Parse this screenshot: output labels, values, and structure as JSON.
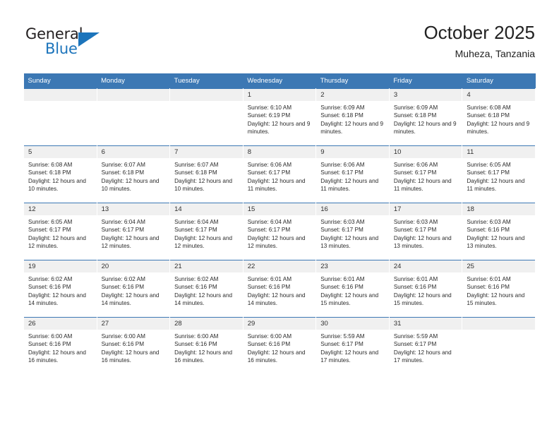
{
  "brand": {
    "line1": "General",
    "line2": "Blue",
    "accent_color": "#1c74bb"
  },
  "header": {
    "title": "October 2025",
    "subtitle": "Muheza, Tanzania"
  },
  "theme": {
    "header_bg": "#3c78b4",
    "daynum_bg": "#f0f0f0",
    "text": "#2b2b2b"
  },
  "weekdays": [
    "Sunday",
    "Monday",
    "Tuesday",
    "Wednesday",
    "Thursday",
    "Friday",
    "Saturday"
  ],
  "weeks": [
    [
      {
        "empty": true
      },
      {
        "empty": true
      },
      {
        "empty": true
      },
      {
        "day": "1",
        "sunrise": "Sunrise: 6:10 AM",
        "sunset": "Sunset: 6:19 PM",
        "daylight": "Daylight: 12 hours and 9 minutes."
      },
      {
        "day": "2",
        "sunrise": "Sunrise: 6:09 AM",
        "sunset": "Sunset: 6:18 PM",
        "daylight": "Daylight: 12 hours and 9 minutes."
      },
      {
        "day": "3",
        "sunrise": "Sunrise: 6:09 AM",
        "sunset": "Sunset: 6:18 PM",
        "daylight": "Daylight: 12 hours and 9 minutes."
      },
      {
        "day": "4",
        "sunrise": "Sunrise: 6:08 AM",
        "sunset": "Sunset: 6:18 PM",
        "daylight": "Daylight: 12 hours and 9 minutes."
      }
    ],
    [
      {
        "day": "5",
        "sunrise": "Sunrise: 6:08 AM",
        "sunset": "Sunset: 6:18 PM",
        "daylight": "Daylight: 12 hours and 10 minutes."
      },
      {
        "day": "6",
        "sunrise": "Sunrise: 6:07 AM",
        "sunset": "Sunset: 6:18 PM",
        "daylight": "Daylight: 12 hours and 10 minutes."
      },
      {
        "day": "7",
        "sunrise": "Sunrise: 6:07 AM",
        "sunset": "Sunset: 6:18 PM",
        "daylight": "Daylight: 12 hours and 10 minutes."
      },
      {
        "day": "8",
        "sunrise": "Sunrise: 6:06 AM",
        "sunset": "Sunset: 6:17 PM",
        "daylight": "Daylight: 12 hours and 11 minutes."
      },
      {
        "day": "9",
        "sunrise": "Sunrise: 6:06 AM",
        "sunset": "Sunset: 6:17 PM",
        "daylight": "Daylight: 12 hours and 11 minutes."
      },
      {
        "day": "10",
        "sunrise": "Sunrise: 6:06 AM",
        "sunset": "Sunset: 6:17 PM",
        "daylight": "Daylight: 12 hours and 11 minutes."
      },
      {
        "day": "11",
        "sunrise": "Sunrise: 6:05 AM",
        "sunset": "Sunset: 6:17 PM",
        "daylight": "Daylight: 12 hours and 11 minutes."
      }
    ],
    [
      {
        "day": "12",
        "sunrise": "Sunrise: 6:05 AM",
        "sunset": "Sunset: 6:17 PM",
        "daylight": "Daylight: 12 hours and 12 minutes."
      },
      {
        "day": "13",
        "sunrise": "Sunrise: 6:04 AM",
        "sunset": "Sunset: 6:17 PM",
        "daylight": "Daylight: 12 hours and 12 minutes."
      },
      {
        "day": "14",
        "sunrise": "Sunrise: 6:04 AM",
        "sunset": "Sunset: 6:17 PM",
        "daylight": "Daylight: 12 hours and 12 minutes."
      },
      {
        "day": "15",
        "sunrise": "Sunrise: 6:04 AM",
        "sunset": "Sunset: 6:17 PM",
        "daylight": "Daylight: 12 hours and 12 minutes."
      },
      {
        "day": "16",
        "sunrise": "Sunrise: 6:03 AM",
        "sunset": "Sunset: 6:17 PM",
        "daylight": "Daylight: 12 hours and 13 minutes."
      },
      {
        "day": "17",
        "sunrise": "Sunrise: 6:03 AM",
        "sunset": "Sunset: 6:17 PM",
        "daylight": "Daylight: 12 hours and 13 minutes."
      },
      {
        "day": "18",
        "sunrise": "Sunrise: 6:03 AM",
        "sunset": "Sunset: 6:16 PM",
        "daylight": "Daylight: 12 hours and 13 minutes."
      }
    ],
    [
      {
        "day": "19",
        "sunrise": "Sunrise: 6:02 AM",
        "sunset": "Sunset: 6:16 PM",
        "daylight": "Daylight: 12 hours and 14 minutes."
      },
      {
        "day": "20",
        "sunrise": "Sunrise: 6:02 AM",
        "sunset": "Sunset: 6:16 PM",
        "daylight": "Daylight: 12 hours and 14 minutes."
      },
      {
        "day": "21",
        "sunrise": "Sunrise: 6:02 AM",
        "sunset": "Sunset: 6:16 PM",
        "daylight": "Daylight: 12 hours and 14 minutes."
      },
      {
        "day": "22",
        "sunrise": "Sunrise: 6:01 AM",
        "sunset": "Sunset: 6:16 PM",
        "daylight": "Daylight: 12 hours and 14 minutes."
      },
      {
        "day": "23",
        "sunrise": "Sunrise: 6:01 AM",
        "sunset": "Sunset: 6:16 PM",
        "daylight": "Daylight: 12 hours and 15 minutes."
      },
      {
        "day": "24",
        "sunrise": "Sunrise: 6:01 AM",
        "sunset": "Sunset: 6:16 PM",
        "daylight": "Daylight: 12 hours and 15 minutes."
      },
      {
        "day": "25",
        "sunrise": "Sunrise: 6:01 AM",
        "sunset": "Sunset: 6:16 PM",
        "daylight": "Daylight: 12 hours and 15 minutes."
      }
    ],
    [
      {
        "day": "26",
        "sunrise": "Sunrise: 6:00 AM",
        "sunset": "Sunset: 6:16 PM",
        "daylight": "Daylight: 12 hours and 16 minutes."
      },
      {
        "day": "27",
        "sunrise": "Sunrise: 6:00 AM",
        "sunset": "Sunset: 6:16 PM",
        "daylight": "Daylight: 12 hours and 16 minutes."
      },
      {
        "day": "28",
        "sunrise": "Sunrise: 6:00 AM",
        "sunset": "Sunset: 6:16 PM",
        "daylight": "Daylight: 12 hours and 16 minutes."
      },
      {
        "day": "29",
        "sunrise": "Sunrise: 6:00 AM",
        "sunset": "Sunset: 6:16 PM",
        "daylight": "Daylight: 12 hours and 16 minutes."
      },
      {
        "day": "30",
        "sunrise": "Sunrise: 5:59 AM",
        "sunset": "Sunset: 6:17 PM",
        "daylight": "Daylight: 12 hours and 17 minutes."
      },
      {
        "day": "31",
        "sunrise": "Sunrise: 5:59 AM",
        "sunset": "Sunset: 6:17 PM",
        "daylight": "Daylight: 12 hours and 17 minutes."
      },
      {
        "empty": true
      }
    ]
  ]
}
